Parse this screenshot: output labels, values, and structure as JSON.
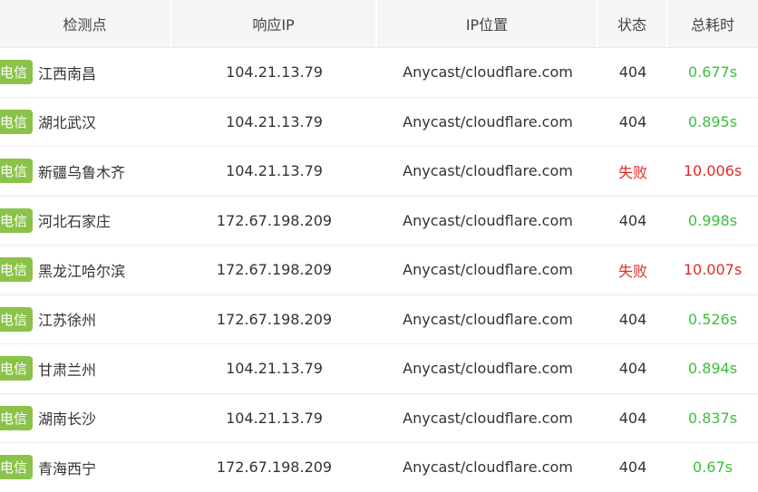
{
  "headers": {
    "node": "检测点",
    "ip": "响应IP",
    "location": "IP位置",
    "status": "状态",
    "time": "总耗时"
  },
  "rows": [
    {
      "isp": "电信",
      "node": "江西南昌",
      "ip": "104.21.13.79",
      "location": "Anycast/cloudflare.com",
      "status": "404",
      "time": "0.677s",
      "ok": true
    },
    {
      "isp": "电信",
      "node": "湖北武汉",
      "ip": "104.21.13.79",
      "location": "Anycast/cloudflare.com",
      "status": "404",
      "time": "0.895s",
      "ok": true
    },
    {
      "isp": "电信",
      "node": "新疆乌鲁木齐",
      "ip": "104.21.13.79",
      "location": "Anycast/cloudflare.com",
      "status": "失败",
      "time": "10.006s",
      "ok": false
    },
    {
      "isp": "电信",
      "node": "河北石家庄",
      "ip": "172.67.198.209",
      "location": "Anycast/cloudflare.com",
      "status": "404",
      "time": "0.998s",
      "ok": true
    },
    {
      "isp": "电信",
      "node": "黑龙江哈尔滨",
      "ip": "172.67.198.209",
      "location": "Anycast/cloudflare.com",
      "status": "失败",
      "time": "10.007s",
      "ok": false
    },
    {
      "isp": "电信",
      "node": "江苏徐州",
      "ip": "172.67.198.209",
      "location": "Anycast/cloudflare.com",
      "status": "404",
      "time": "0.526s",
      "ok": true
    },
    {
      "isp": "电信",
      "node": "甘肃兰州",
      "ip": "104.21.13.79",
      "location": "Anycast/cloudflare.com",
      "status": "404",
      "time": "0.894s",
      "ok": true
    },
    {
      "isp": "电信",
      "node": "湖南长沙",
      "ip": "104.21.13.79",
      "location": "Anycast/cloudflare.com",
      "status": "404",
      "time": "0.837s",
      "ok": true
    },
    {
      "isp": "电信",
      "node": "青海西宁",
      "ip": "172.67.198.209",
      "location": "Anycast/cloudflare.com",
      "status": "404",
      "time": "0.67s",
      "ok": true
    }
  ],
  "colors": {
    "isp_badge": "#8bc34a",
    "ok_time": "#3cbf3c",
    "fail": "#e02b2b",
    "header_bg": "#f5f5f5"
  }
}
